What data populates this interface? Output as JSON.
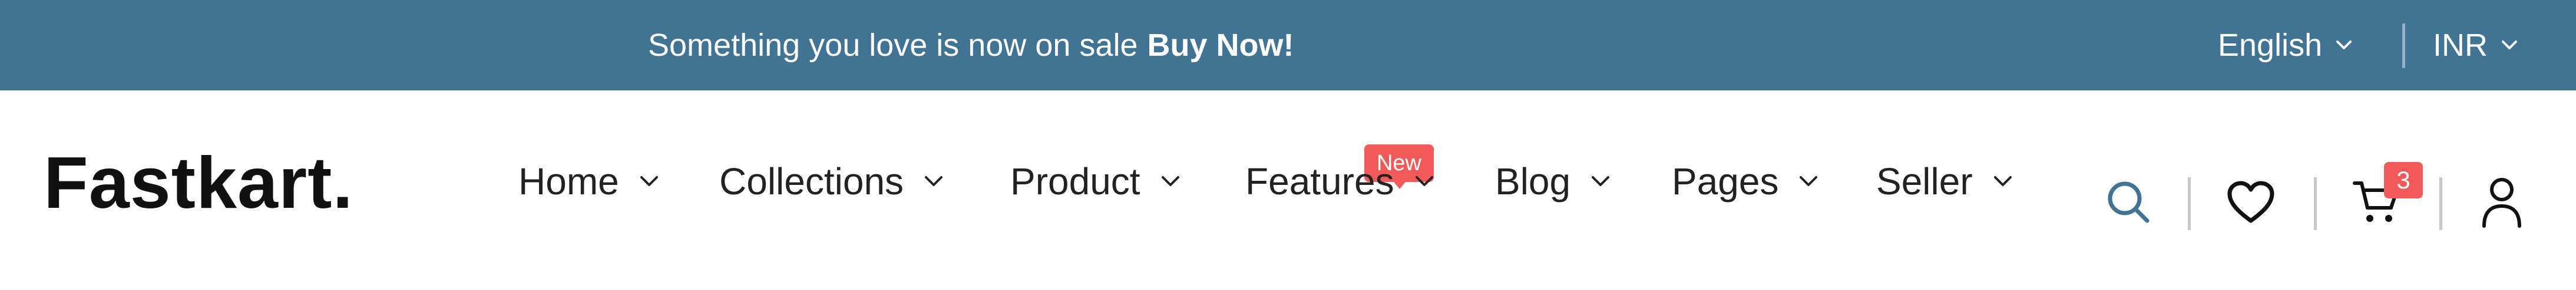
{
  "topbar": {
    "promo_text": "Something you love is now on sale",
    "promo_cta": "Buy Now!",
    "language": "English",
    "currency": "INR"
  },
  "header": {
    "logo": "Fastkart."
  },
  "nav": {
    "items": [
      {
        "label": "Home"
      },
      {
        "label": "Collections"
      },
      {
        "label": "Product"
      },
      {
        "label": "Features",
        "badge": "New"
      },
      {
        "label": "Blog"
      },
      {
        "label": "Pages"
      },
      {
        "label": "Seller"
      }
    ]
  },
  "actions": {
    "icons": [
      "search-icon",
      "heart-icon",
      "cart-icon",
      "user-icon"
    ],
    "cart_count": "3"
  },
  "colors": {
    "topbar_bg": "#417394",
    "badge": "#f25a5a",
    "text": "#222222",
    "search_icon": "#417394"
  }
}
